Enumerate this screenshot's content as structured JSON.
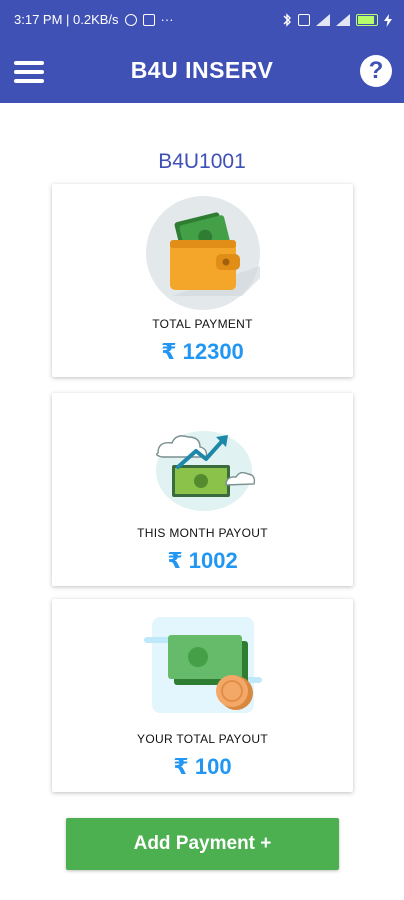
{
  "status_bar": {
    "time_info": "3:17 PM | 0.2KB/s",
    "more": "···",
    "battery": "100"
  },
  "app_bar": {
    "title": "B4U INSERV"
  },
  "user": {
    "id": "B4U1001"
  },
  "cards": [
    {
      "label": "TOTAL PAYMENT",
      "value": "₹ 12300"
    },
    {
      "label": "THIS MONTH PAYOUT",
      "value": "₹ 1002"
    },
    {
      "label": "YOUR TOTAL PAYOUT",
      "value": "₹ 100"
    }
  ],
  "actions": {
    "add_payment": "Add Payment +"
  },
  "colors": {
    "primary": "#3F51B5",
    "accent_value": "#2196F3",
    "button": "#4CAF50"
  },
  "icons": [
    "menu-icon",
    "help-icon",
    "wallet-icon",
    "money-growth-icon",
    "cash-coins-icon"
  ]
}
